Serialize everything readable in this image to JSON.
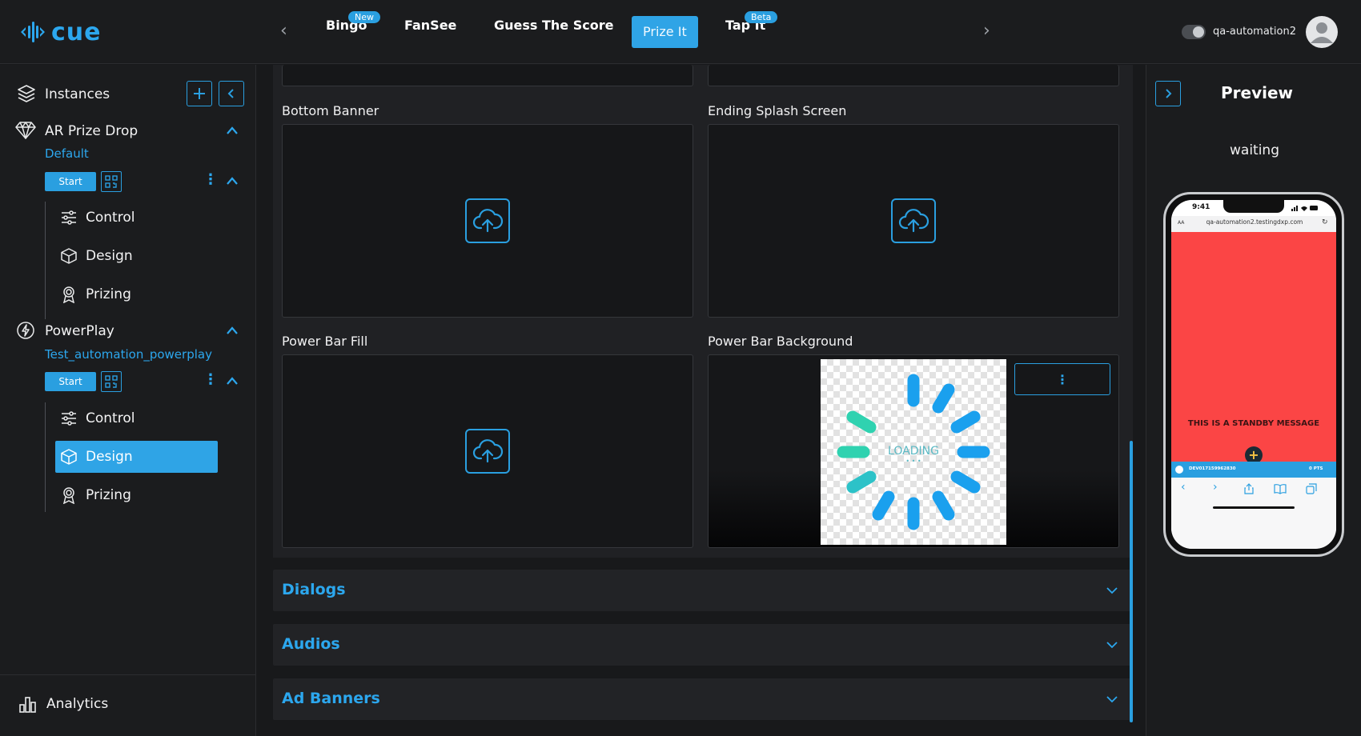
{
  "app": {
    "logo_text": "cue"
  },
  "topnav": {
    "tabs": [
      {
        "label": "Bingo",
        "badge": "New"
      },
      {
        "label": "FanSee",
        "badge": ""
      },
      {
        "label": "Guess The Score",
        "badge": ""
      },
      {
        "label": "Prize It",
        "badge": "",
        "active": true
      },
      {
        "label": "Tap It",
        "badge": "Beta"
      }
    ],
    "username": "qa-automation2"
  },
  "sidebar": {
    "header": "Instances",
    "games": [
      {
        "name": "AR Prize Drop",
        "instance": "Default",
        "start_label": "Start",
        "items": [
          "Control",
          "Design",
          "Prizing"
        ]
      },
      {
        "name": "PowerPlay",
        "instance": "Test_automation_powerplay",
        "start_label": "Start",
        "items": [
          "Control",
          "Design",
          "Prizing"
        ],
        "active_item": "Design"
      }
    ],
    "footer": "Analytics"
  },
  "assets": [
    {
      "label": "Bottom Banner"
    },
    {
      "label": "Ending Splash Screen"
    },
    {
      "label": "Power Bar Fill"
    },
    {
      "label": "Power Bar Background",
      "image_text": "LOADING",
      "image_dots": "• • •"
    }
  ],
  "sections": [
    {
      "title": "Dialogs"
    },
    {
      "title": "Audios"
    },
    {
      "title": "Ad Banners"
    }
  ],
  "preview": {
    "title": "Preview",
    "status": "waiting",
    "phone": {
      "time": "9:41",
      "aa": "AA",
      "url": "qa-automation2.testingdxp.com",
      "standby_message": "THIS IS A STANDBY MESSAGE",
      "device_id": "DEV017159962830",
      "points": "0 PTS"
    }
  },
  "colors": {
    "accent": "#2a9fe0",
    "bg": "#18191b",
    "panel": "#202124",
    "phone_bg": "#fb4545"
  }
}
